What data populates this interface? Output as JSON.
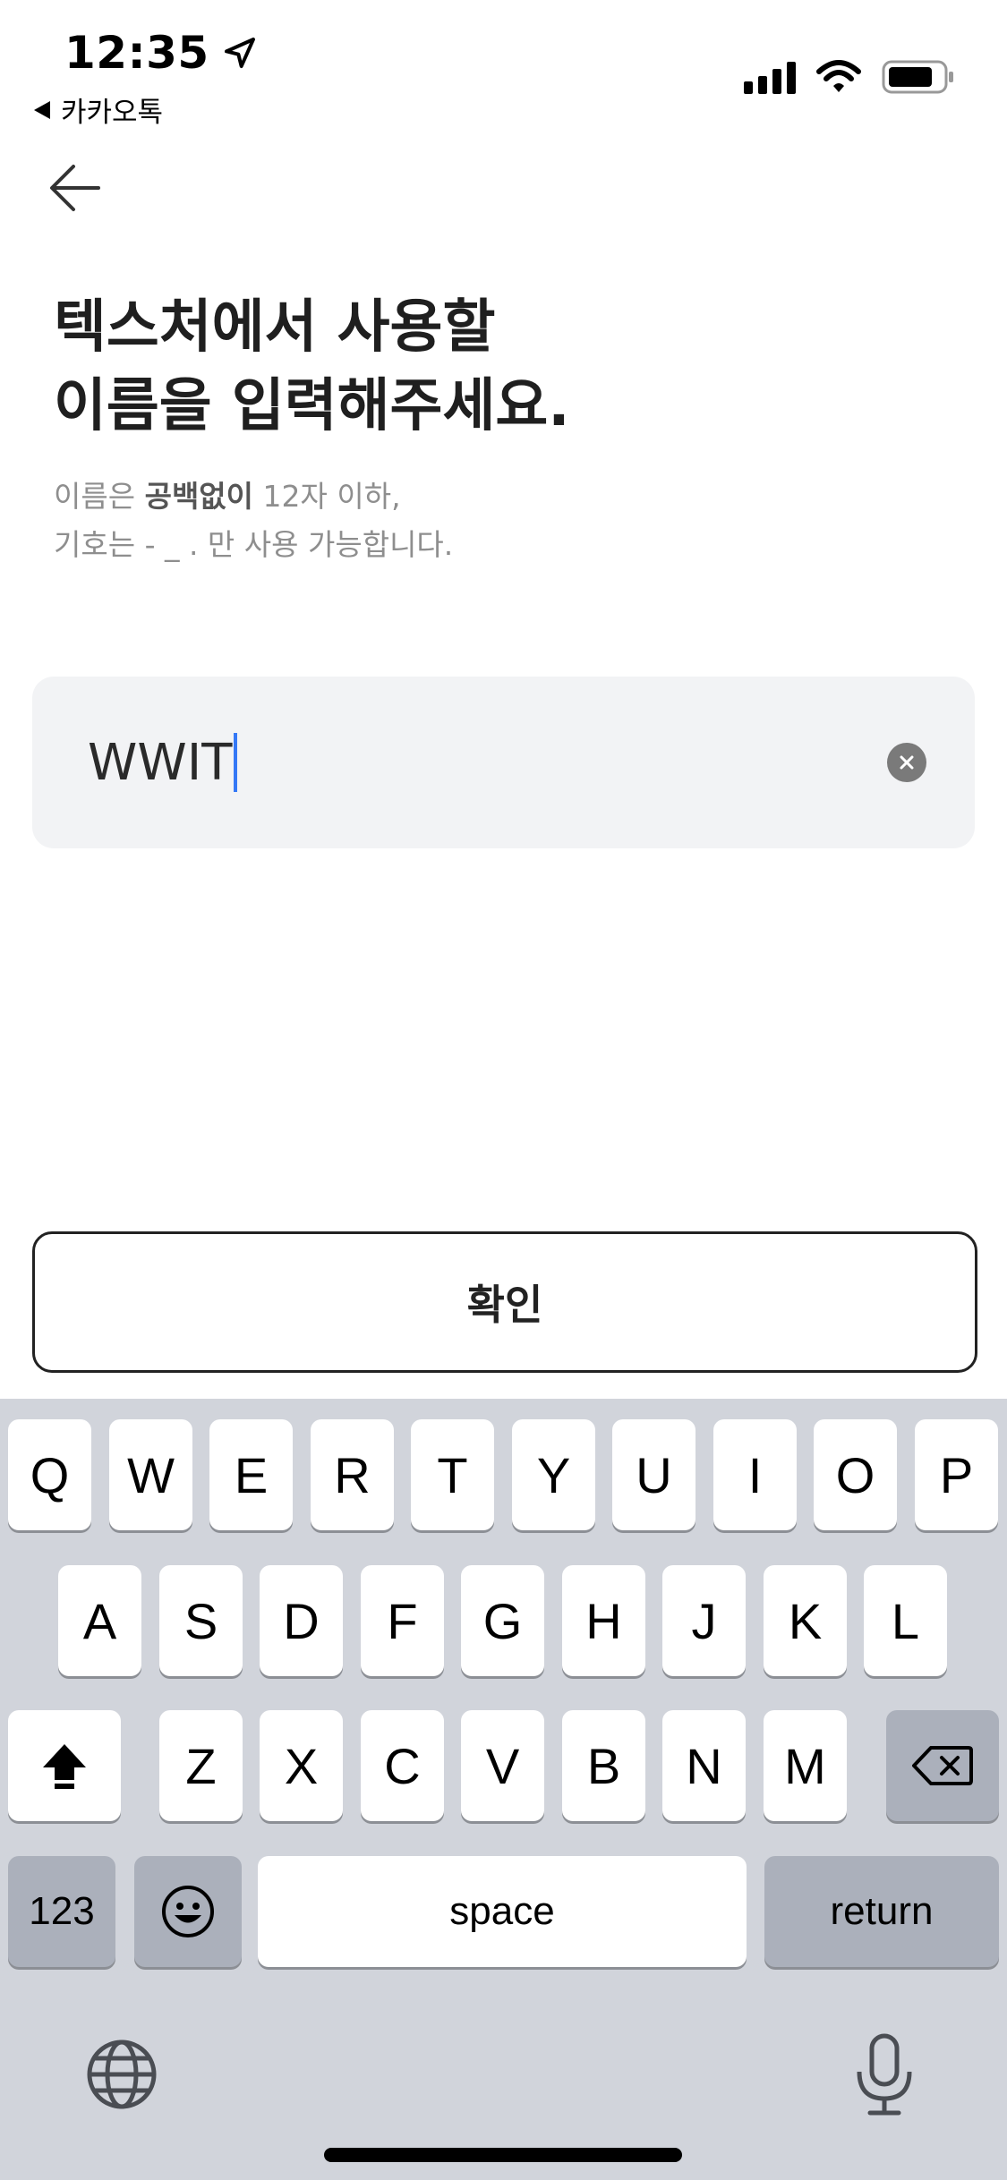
{
  "status_bar": {
    "time": "12:35",
    "back_app": "카카오톡"
  },
  "header": {
    "title_line1": "텍스처에서 사용할",
    "title_line2": "이름을 입력해주세요.",
    "sub_line1_pre": "이름은 ",
    "sub_line1_bold": "공백없이",
    "sub_line1_post": " 12자 이하,",
    "sub_line2": "기호는 - _ . 만 사용 가능합니다."
  },
  "name_input": {
    "value": "WWIT"
  },
  "confirm_label": "확인",
  "keyboard": {
    "row1": [
      "Q",
      "W",
      "E",
      "R",
      "T",
      "Y",
      "U",
      "I",
      "O",
      "P"
    ],
    "row2": [
      "A",
      "S",
      "D",
      "F",
      "G",
      "H",
      "J",
      "K",
      "L"
    ],
    "row3": [
      "Z",
      "X",
      "C",
      "V",
      "B",
      "N",
      "M"
    ],
    "numbers_label": "123",
    "space_label": "space",
    "return_label": "return"
  },
  "icons": {
    "back": "arrow-left-icon",
    "location": "location-arrow-icon",
    "signal": "cellular-signal-icon",
    "wifi": "wifi-icon",
    "battery": "battery-icon",
    "clear": "clear-x-icon",
    "shift": "shift-icon",
    "delete": "backspace-icon",
    "emoji": "emoji-icon",
    "globe": "globe-icon",
    "mic": "microphone-icon"
  },
  "colors": {
    "caret": "#3478f6",
    "keyboard_bg": "#d1d4db"
  }
}
